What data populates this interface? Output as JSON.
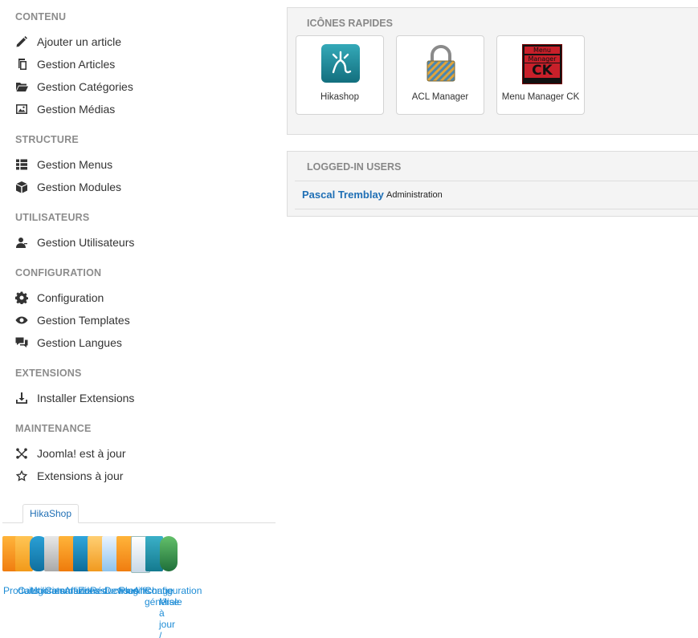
{
  "sidebar": {
    "sections": [
      {
        "title": "CONTENU"
      },
      {
        "title": "STRUCTURE"
      },
      {
        "title": "UTILISATEURS"
      },
      {
        "title": "CONFIGURATION"
      },
      {
        "title": "EXTENSIONS"
      },
      {
        "title": "MAINTENANCE"
      }
    ],
    "items": [
      {
        "label": "Ajouter un article",
        "icon": "pencil-icon"
      },
      {
        "label": "Gestion Articles",
        "icon": "copy-icon"
      },
      {
        "label": "Gestion Catégories",
        "icon": "folder-open-icon"
      },
      {
        "label": "Gestion Médias",
        "icon": "image-icon"
      },
      {
        "label": "Gestion Menus",
        "icon": "list-icon"
      },
      {
        "label": "Gestion Modules",
        "icon": "cube-icon"
      },
      {
        "label": "Gestion Utilisateurs",
        "icon": "user-icon"
      },
      {
        "label": "Configuration",
        "icon": "cog-icon"
      },
      {
        "label": "Gestion Templates",
        "icon": "eye-icon"
      },
      {
        "label": "Gestion Langues",
        "icon": "comments-icon"
      },
      {
        "label": "Installer Extensions",
        "icon": "download-icon"
      },
      {
        "label": "Joomla! est à jour",
        "icon": "joomla-icon"
      },
      {
        "label": "Extensions à jour",
        "icon": "star-icon"
      }
    ]
  },
  "hikashop": {
    "tab_label": "HikaShop",
    "labels": [
      "Produits",
      "Catégories",
      "Utilisateurs",
      "Commandes",
      "Affiliés",
      "Zones",
      "Réductions",
      "Devises",
      "Plugins",
      "Affichage",
      "Configuration générale",
      "Mise à jour / A"
    ]
  },
  "quick_icons": {
    "title": "ICÔNES RAPIDES",
    "items": [
      {
        "label": "Hikashop",
        "icon": "hikashop-logo-icon"
      },
      {
        "label": "ACL Manager",
        "icon": "padlock-icon"
      },
      {
        "label": "Menu Manager CK",
        "icon": "menu-manager-ck-icon",
        "logo_text": [
          "Menu",
          "Manager",
          "CK"
        ]
      }
    ]
  },
  "logged_in": {
    "title": "LOGGED-IN USERS",
    "users": [
      {
        "name": "Pascal Tremblay",
        "role": "Administration"
      }
    ]
  },
  "colors": {
    "link": "#1f6fb5",
    "section_title": "#8c8c8c",
    "panel_bg": "#f4f4f4",
    "hikashop_teal": "#1c8a9a"
  }
}
